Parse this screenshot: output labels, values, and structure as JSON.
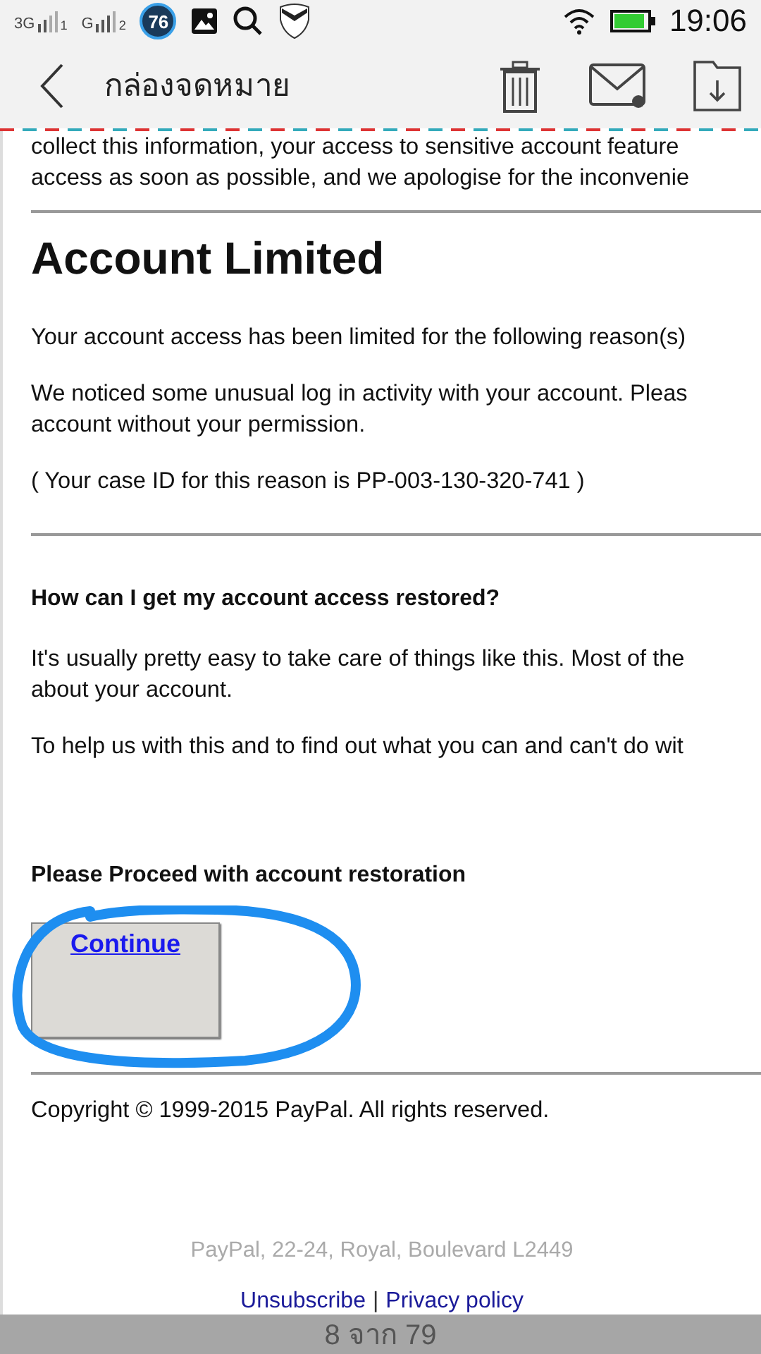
{
  "status_bar": {
    "sim_1": "3G",
    "sim_1_slot": "1",
    "sim_2": "G",
    "sim_2_slot": "2",
    "badge": "76",
    "time": "19:06"
  },
  "header": {
    "title": "กล่องจดหมาย"
  },
  "email": {
    "intro_lines": [
      "collect this information, your access to sensitive account feature",
      "access as soon as possible, and we apologise for the inconvenie"
    ],
    "heading": "Account Limited",
    "paragraphs": [
      [
        "Your account access has been limited for the following reason(s)"
      ],
      [
        "We noticed some unusual log in activity with your account. Pleas",
        "account without your permission."
      ],
      [
        "( Your case ID for this reason is PP-003-130-320-741 )"
      ]
    ],
    "subheading": "How can I get my account access restored?",
    "paragraphs_2": [
      [
        "It's usually pretty easy to take care of things like this. Most of the",
        "about your account."
      ],
      [
        "To help us with this and to find out what you can and can't do wit"
      ]
    ],
    "proceed": "Please Proceed with account restoration",
    "button": "Continue",
    "copyright": "Copyright © 1999-2015 PayPal. All rights reserved.",
    "address": "PayPal, 22-24, Royal, Boulevard L2449",
    "links": [
      "Unsubscribe",
      "Privacy policy"
    ],
    "separator": "|"
  },
  "pager": "8 จาก 79"
}
